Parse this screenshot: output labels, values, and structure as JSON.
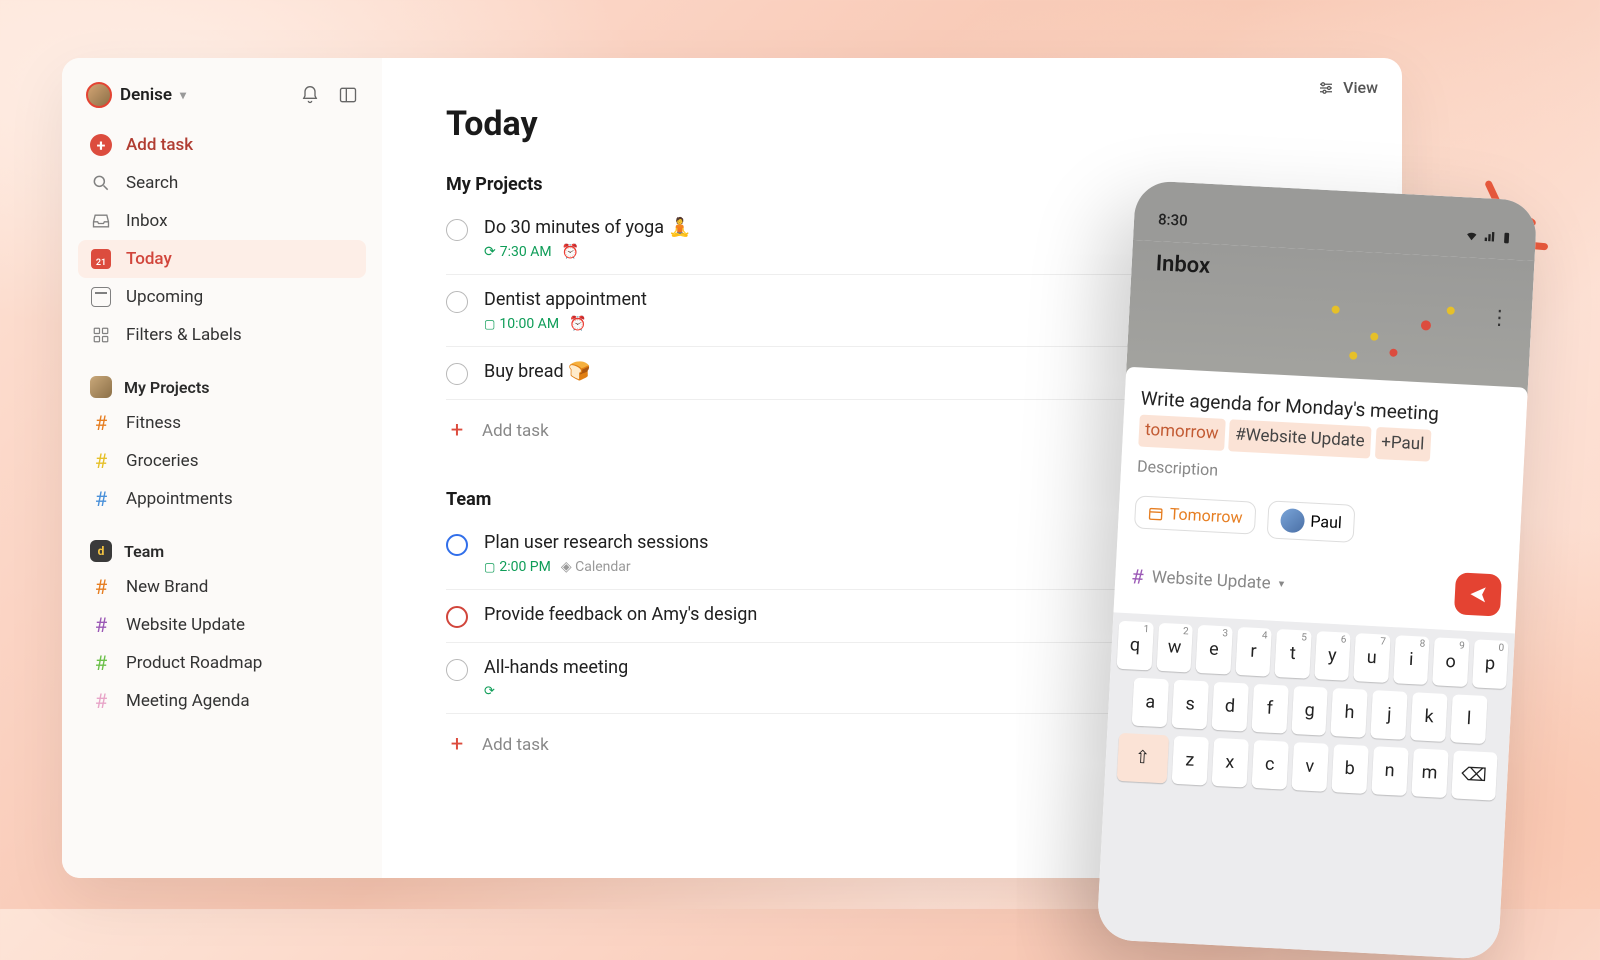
{
  "sidebar": {
    "user_name": "Denise",
    "add_task": "Add task",
    "nav": {
      "search": "Search",
      "inbox": "Inbox",
      "today": "Today",
      "today_badge": "21",
      "upcoming": "Upcoming",
      "filters": "Filters & Labels"
    },
    "projects_header": "My Projects",
    "projects": [
      {
        "label": "Fitness",
        "color": "orange"
      },
      {
        "label": "Groceries",
        "color": "yellow"
      },
      {
        "label": "Appointments",
        "color": "blue"
      }
    ],
    "team_header": "Team",
    "team_projects": [
      {
        "label": "New Brand",
        "color": "orange"
      },
      {
        "label": "Website Update",
        "color": "purple"
      },
      {
        "label": "Product Roadmap",
        "color": "green"
      },
      {
        "label": "Meeting Agenda",
        "color": "pink"
      }
    ]
  },
  "main": {
    "view_label": "View",
    "title": "Today",
    "sections": [
      {
        "title": "My Projects",
        "tasks": [
          {
            "title": "Do 30 minutes of yoga 🧘",
            "time": "7:30 AM",
            "recurring": true,
            "alarm": true,
            "priority": ""
          },
          {
            "title": "Dentist appointment",
            "time": "10:00 AM",
            "recurring": false,
            "alarm": true,
            "date_icon": true,
            "priority": ""
          },
          {
            "title": "Buy bread 🍞",
            "time": "",
            "priority": ""
          }
        ],
        "add_label": "Add task"
      },
      {
        "title": "Team",
        "tasks": [
          {
            "title": "Plan user research sessions",
            "time": "2:00 PM",
            "date_icon": true,
            "calendar": "Calendar",
            "priority": "p2"
          },
          {
            "title": "Provide feedback on Amy's design",
            "time": "",
            "priority": "p1"
          },
          {
            "title": "All-hands meeting",
            "time": "",
            "recurring": true,
            "priority": ""
          }
        ],
        "add_label": "Add task"
      }
    ]
  },
  "phone": {
    "status_time": "8:30",
    "header_title": "Inbox",
    "task_text": "Write agenda for Monday's meeting",
    "chip_date": "tomorrow",
    "chip_tag": "#Website Update",
    "chip_assign": "+Paul",
    "description_label": "Description",
    "pill_date": "Tomorrow",
    "pill_person": "Paul",
    "project_select": "Website Update",
    "kb_row1": [
      "q",
      "w",
      "e",
      "r",
      "t",
      "y",
      "u",
      "i",
      "o",
      "p"
    ],
    "kb_sup1": [
      "1",
      "2",
      "3",
      "4",
      "5",
      "6",
      "7",
      "8",
      "9",
      "0"
    ],
    "kb_row2": [
      "a",
      "s",
      "d",
      "f",
      "g",
      "h",
      "j",
      "k",
      "l"
    ],
    "kb_row3": [
      "z",
      "x",
      "c",
      "v",
      "b",
      "n",
      "m"
    ]
  }
}
